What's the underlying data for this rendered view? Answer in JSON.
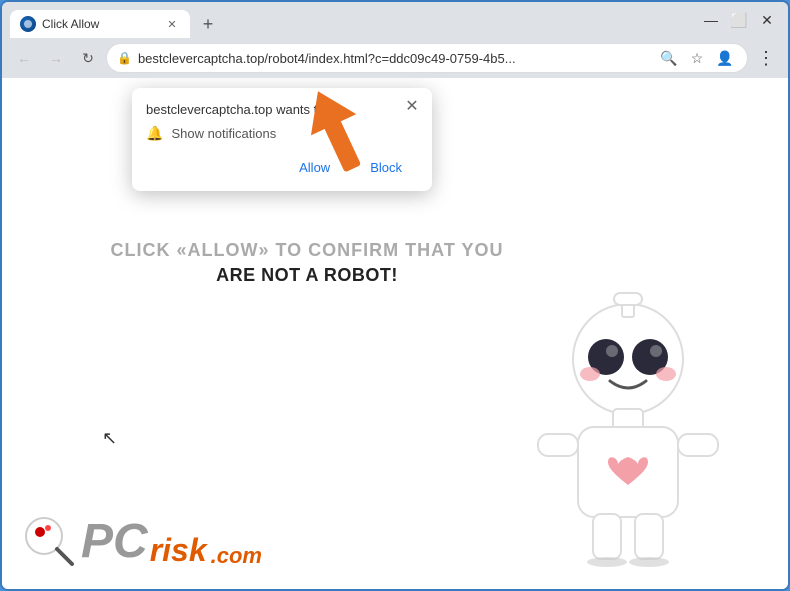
{
  "browser": {
    "tab": {
      "title": "Click Allow",
      "favicon_label": "browser-favicon"
    },
    "new_tab_icon": "+",
    "window_controls": {
      "minimize": "—",
      "maximize": "⬜",
      "close": "✕"
    },
    "nav": {
      "back": "←",
      "forward": "→",
      "refresh": "↻"
    },
    "address": "bestclevercaptcha.top/robot4/index.html?c=ddc09c49-0759-4b5...",
    "address_icons": {
      "search": "🔍",
      "bookmark": "☆",
      "profile": "👤"
    },
    "menu": "⋮"
  },
  "notification_popup": {
    "title": "bestclevercaptcha.top wants to",
    "notification_label": "Show notifications",
    "close_label": "✕",
    "allow_button": "Allow",
    "block_button": "Block"
  },
  "page": {
    "captcha_line1": "CLICK «ALLOW» TO CONFIRM THAT YOU",
    "captcha_line2": "ARE NOT A ROBOT!",
    "logo_pc": "PC",
    "logo_risk": "risk",
    "logo_dotcom": ".com"
  }
}
